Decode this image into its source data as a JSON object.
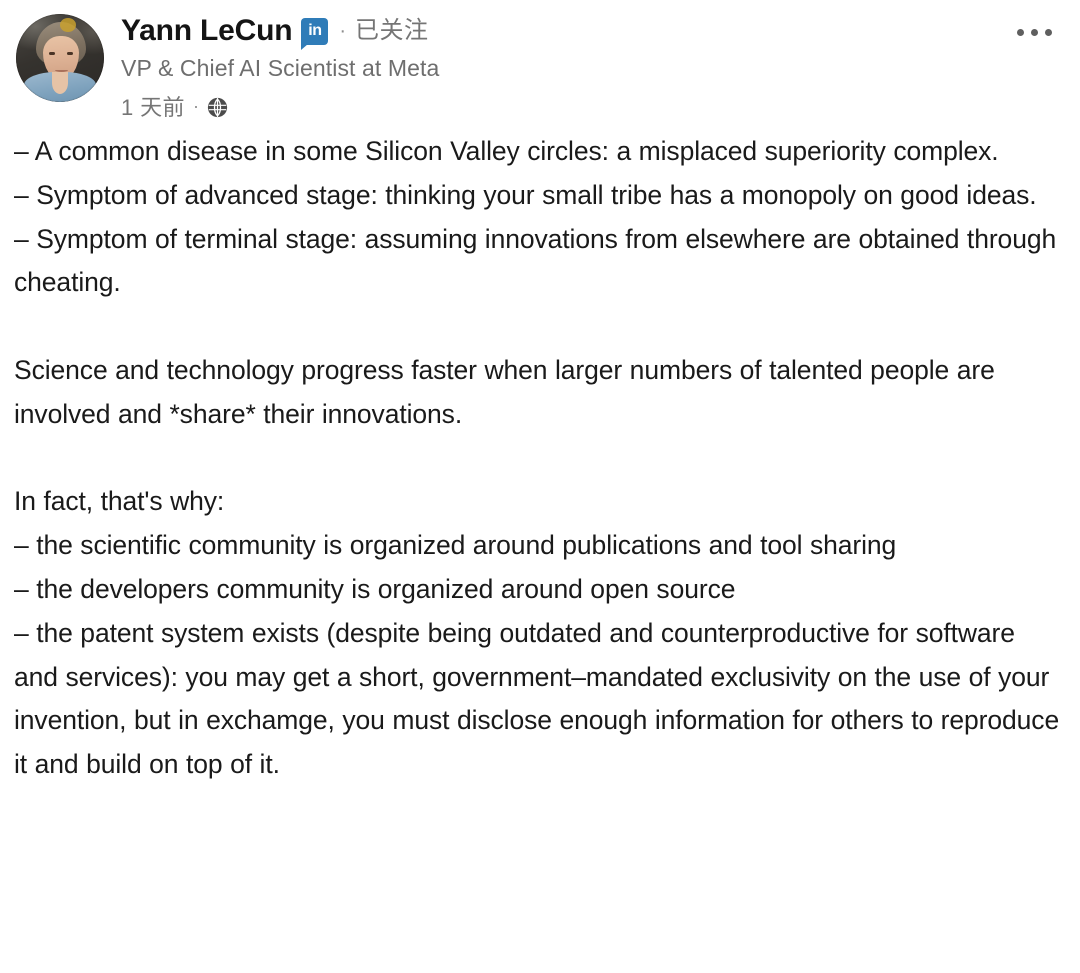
{
  "post": {
    "author": {
      "name": "Yann LeCun",
      "verified_badge": "linkedin-logo",
      "badge_text": "in",
      "separator": "·",
      "follow_state": "已关注",
      "headline": "VP & Chief AI Scientist at Meta",
      "timestamp": "1 天前",
      "meta_separator": "·",
      "visibility_icon": "globe-icon",
      "avatar_alt": "Yann LeCun profile photo"
    },
    "overflow_menu": {
      "icon": "ellipsis-horizontal-icon",
      "label": "更多"
    },
    "content": {
      "lines": [
        "– A common disease in some Silicon Valley circles: a misplaced superiority complex.",
        "– Symptom of advanced stage: thinking your small tribe has a monopoly on good ideas.",
        "– Symptom of terminal stage: assuming innovations from elsewhere are obtained through cheating.",
        "",
        "Science and technology progress faster when larger numbers of talented people are involved and *share* their innovations.",
        "",
        "In fact, that's why:",
        "– the scientific community is organized around publications and tool sharing",
        "– the developers community is organized around open source",
        "– the patent system exists (despite being outdated and counterproductive for software and services): you may get a short, government–mandated exclusivity on the use of your invention, but in exchamge, you must disclose enough information for others to reproduce it and build on top of it."
      ]
    },
    "colors": {
      "background": "#ffffff",
      "primary_text": "#1a1a1a",
      "secondary_text": "#6e6e6e",
      "muted_text": "#757575",
      "linkedin_blue": "#2f7cb8"
    }
  }
}
